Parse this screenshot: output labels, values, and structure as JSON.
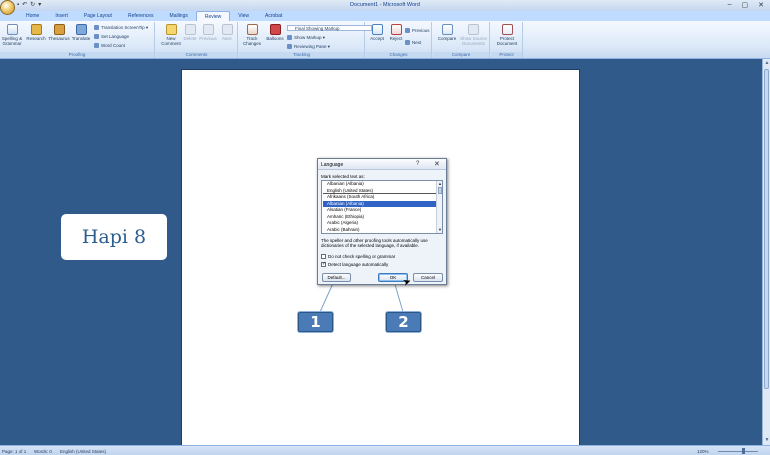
{
  "window": {
    "title": "Document1 - Microsoft Word",
    "controls": {
      "minimize": "–",
      "maximize": "▢",
      "close": "✕"
    }
  },
  "quick_access": {
    "save": "▪",
    "undo": "↶",
    "redo": "↻",
    "more": "▾"
  },
  "ribbon": {
    "tabs": [
      "Home",
      "Insert",
      "Page Layout",
      "References",
      "Mailings",
      "Review",
      "View",
      "Acrobat"
    ],
    "active_tab": "Review",
    "proofing": {
      "label": "Proofing",
      "spelling": "Spelling & Grammar",
      "research": "Research",
      "thesaurus": "Thesaurus",
      "translate": "Translate",
      "screentip": "Translation ScreenTip ▾",
      "set_language": "Set Language",
      "word_count": "Word Count"
    },
    "comments": {
      "label": "Comments",
      "new": "New Comment",
      "delete": "Delete",
      "previous": "Previous",
      "next": "Next"
    },
    "tracking": {
      "label": "Tracking",
      "track_changes": "Track Changes",
      "balloons": "Balloons",
      "markup_combo": "Final Showing Markup",
      "show_markup": "Show Markup ▾",
      "reviewing_pane": "Reviewing Pane ▾"
    },
    "changes": {
      "label": "Changes",
      "accept": "Accept",
      "reject": "Reject",
      "previous": "Previous",
      "next": "Next"
    },
    "compare": {
      "label": "Compare",
      "compare": "Compare",
      "show_source": "Show Source Documents"
    },
    "protect": {
      "label": "Protect",
      "protect_doc": "Protect Document"
    }
  },
  "overlay": {
    "badge_text": "Hapi 8",
    "marker_1": "1",
    "marker_2": "2"
  },
  "dialog": {
    "title": "Language",
    "help": "?",
    "close": "✕",
    "mark_label": "Mark selected text as:",
    "languages": [
      "Albanian (Albania)",
      "English (United States)",
      "Afrikaans (South Africa)",
      "Albanian (Albania)",
      "Alsatian (France)",
      "Amharic (Ethiopia)",
      "Arabic (Algeria)",
      "Arabic (Bahrain)"
    ],
    "selected_index": 3,
    "info": "The speller and other proofing tools automatically use dictionaries of the selected language, if available.",
    "no_check": "Do not check spelling or grammar",
    "detect_auto": "Detect language automatically",
    "no_check_checked": false,
    "detect_auto_checked": true,
    "default_btn": "Default...",
    "ok_btn": "OK",
    "cancel_btn": "Cancel"
  },
  "status": {
    "page": "Page: 1 of 1",
    "words": "Words: 0",
    "language": "English (United States)",
    "zoom": "120%"
  }
}
